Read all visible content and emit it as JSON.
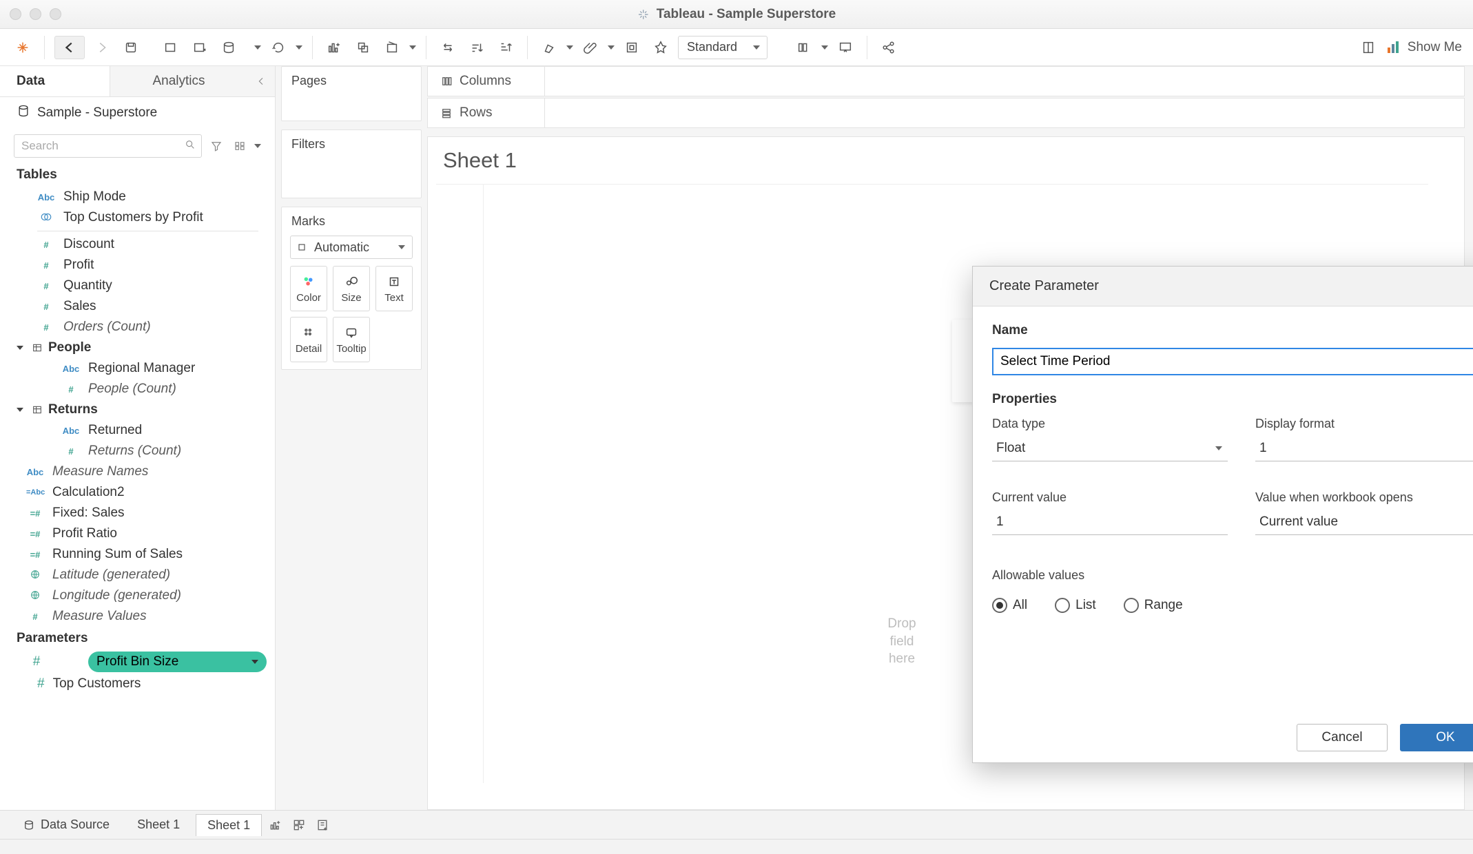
{
  "window": {
    "title": "Tableau - Sample Superstore"
  },
  "toolbar": {
    "fit_select": "Standard",
    "show_me": "Show Me"
  },
  "sidebar": {
    "tabs": {
      "data": "Data",
      "analytics": "Analytics"
    },
    "datasource": "Sample - Superstore",
    "search_placeholder": "Search",
    "tables_label": "Tables",
    "parameters_label": "Parameters",
    "groups": {
      "people": "People",
      "returns": "Returns"
    },
    "fields_top": [
      {
        "icon": "abc",
        "label": "Ship Mode"
      },
      {
        "icon": "set",
        "label": "Top Customers by Profit"
      }
    ],
    "fields_measures": [
      {
        "icon": "num",
        "label": "Discount"
      },
      {
        "icon": "num",
        "label": "Profit"
      },
      {
        "icon": "num",
        "label": "Quantity"
      },
      {
        "icon": "num",
        "label": "Sales"
      },
      {
        "icon": "num",
        "label": "Orders (Count)",
        "italic": true
      }
    ],
    "people_fields": [
      {
        "icon": "abc",
        "label": "Regional Manager"
      },
      {
        "icon": "num",
        "label": "People (Count)",
        "italic": true
      }
    ],
    "returns_fields": [
      {
        "icon": "abc",
        "label": "Returned"
      },
      {
        "icon": "num",
        "label": "Returns (Count)",
        "italic": true
      }
    ],
    "misc_fields": [
      {
        "icon": "abc",
        "label": "Measure Names",
        "italic": true
      },
      {
        "icon": "calcabc",
        "label": "Calculation2"
      },
      {
        "icon": "calcnum",
        "label": "Fixed: Sales"
      },
      {
        "icon": "calcnum",
        "label": "Profit Ratio"
      },
      {
        "icon": "calcnum",
        "label": "Running Sum of Sales"
      },
      {
        "icon": "globe",
        "label": "Latitude (generated)",
        "italic": true
      },
      {
        "icon": "globe",
        "label": "Longitude (generated)",
        "italic": true
      },
      {
        "icon": "num",
        "label": "Measure Values",
        "italic": true
      }
    ],
    "parameters": [
      {
        "icon": "num",
        "label": "Profit Bin Size",
        "active": true
      },
      {
        "icon": "num",
        "label": "Top Customers"
      }
    ]
  },
  "mid": {
    "pages": "Pages",
    "filters": "Filters",
    "marks": "Marks",
    "mark_type": "Automatic",
    "mark_buttons": [
      "Color",
      "Size",
      "Text",
      "Detail",
      "Tooltip"
    ]
  },
  "shelves": {
    "columns": "Columns",
    "rows": "Rows"
  },
  "sheet": {
    "title": "Sheet 1",
    "drop_hint": "Drop\nfield\nhere"
  },
  "dialog": {
    "title": "Create Parameter",
    "name_label": "Name",
    "name_value": "Select Time Period",
    "properties": "Properties",
    "data_type_label": "Data type",
    "data_type_value": "Float",
    "display_format_label": "Display format",
    "display_format_value": "1",
    "current_value_label": "Current value",
    "current_value_value": "1",
    "value_when_label": "Value when workbook opens",
    "value_when_value": "Current value",
    "allowable_label": "Allowable values",
    "radios": {
      "all": "All",
      "list": "List",
      "range": "Range"
    },
    "cancel": "Cancel",
    "ok": "OK"
  },
  "bottom": {
    "data_source": "Data Source",
    "sheet1a": "Sheet 1",
    "sheet1b": "Sheet 1"
  }
}
